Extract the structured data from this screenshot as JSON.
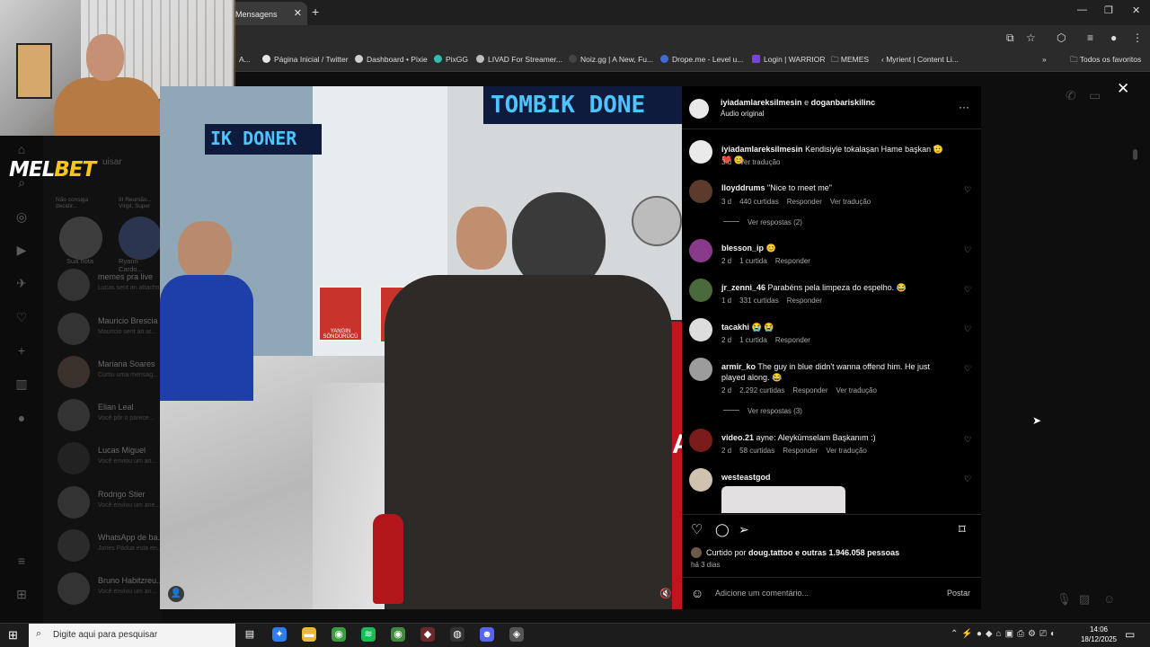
{
  "browser": {
    "active_tab": "Mensagens",
    "bookmarks": [
      {
        "label": "A...",
        "color": "#555555"
      },
      {
        "label": "Página Inicial / Twitter",
        "color": "#e7e7e7"
      },
      {
        "label": "Dashboard • Pixie",
        "color": "#cfcfcf"
      },
      {
        "label": "PixGG",
        "color": "#32bcad"
      },
      {
        "label": "LIVAD For Streamer...",
        "color": "#bdbdbd"
      },
      {
        "label": "Noiz.gg | A New, Fu...",
        "color": "#1f1f1f"
      },
      {
        "label": "Drope.me - Level u...",
        "color": "#3e6bd6"
      },
      {
        "label": "Login | WARRIOR",
        "color": "#7a44d9"
      },
      {
        "label": "MEMES",
        "color": "#9a9a9a"
      },
      {
        "label": "Myrient | Content Li...",
        "color": "#8a8a8a"
      }
    ],
    "all_favorites": "Todos os favoritos"
  },
  "overlay": {
    "brand_a": "MEL",
    "brand_b": "BET"
  },
  "dm_sidebar": {
    "search_placeholder": "uisar",
    "notes": [
      {
        "label": "Não consiga decidir...",
        "name": "Sua nota"
      },
      {
        "label": "III Reunião... Virgil, Super",
        "name": "Ryann Cardo..."
      }
    ],
    "conversations": [
      {
        "name": "memes pra live",
        "preview": "Lucas sent an attachm..."
      },
      {
        "name": "Mauricio Brescia",
        "preview": "Mauricio sent an at..."
      },
      {
        "name": "Mariana Soares",
        "preview": "Curtiu uma mensag..."
      },
      {
        "name": "Elian Leal",
        "preview": "Você pôr o parece..."
      },
      {
        "name": "Lucas Miguel",
        "preview": "Você enviou um an..."
      },
      {
        "name": "Rodrigo Stier",
        "preview": "Você enviou um ane..."
      },
      {
        "name": "WhatsApp de ba...",
        "preview": "Jones Pádua esta en..."
      },
      {
        "name": "Bruno Habitzreu...",
        "preview": "Você enviou um an..."
      }
    ]
  },
  "video": {
    "sign_top": "TOMBIK DONE",
    "sign_left": "IK DONER",
    "ext_label_1": "YANGIN SÖNDÜRÜCÜ",
    "ext_label_2": "YANGIN SÖNDÜRÜCÜ",
    "side_text": "SAR"
  },
  "post": {
    "authors": "iyiadamlareksilmesin",
    "connector": "e",
    "coauthor": "doganbariskilinc",
    "audio": "Áudio original",
    "caption_user": "iyiadamlareksilmesin",
    "caption_text": "Kendisiyle tokalaşan Hame başkan 🫡 ❤️ 😊",
    "caption_meta": [
      "3 d",
      "Ver tradução"
    ],
    "comments": [
      {
        "user": "lloyddrums",
        "text": "\"Nice to meet me\"",
        "meta": [
          "3 d",
          "440 curtidas",
          "Responder",
          "Ver tradução"
        ],
        "replies": "Ver respostas (2)",
        "avatar_color": "#5a3b2c"
      },
      {
        "user": "blesson_ip",
        "text": "😊",
        "meta": [
          "2 d",
          "1 curtida",
          "Responder"
        ],
        "replies": "",
        "avatar_color": "#8a3a8a"
      },
      {
        "user": "jr_zenni_46",
        "text": "Parabéns pela limpeza do espelho. 😂",
        "meta": [
          "1 d",
          "331 curtidas",
          "Responder"
        ],
        "replies": "",
        "avatar_color": "#4b6a3b"
      },
      {
        "user": "tacakhi",
        "text": "😭 😭",
        "meta": [
          "2 d",
          "1 curtida",
          "Responder"
        ],
        "replies": "",
        "avatar_color": "#dddddd"
      },
      {
        "user": "armir_ko",
        "text": "The guy in blue didn't wanna offend him. He just played along. 😂",
        "meta": [
          "2 d",
          "2.292 curtidas",
          "Responder",
          "Ver tradução"
        ],
        "replies": "Ver respostas (3)",
        "avatar_color": "#9c9c9c"
      },
      {
        "user": "video.21",
        "text": "ayne: Aleykümselam Başkanım :)",
        "meta": [
          "2 d",
          "58 curtidas",
          "Responder",
          "Ver tradução"
        ],
        "replies": "",
        "avatar_color": "#7b1c1c"
      },
      {
        "user": "westeastgod",
        "text": "",
        "meta": [],
        "replies": "",
        "avatar_color": "#cfc3b0"
      }
    ],
    "liked_by_prefix": "Curtido por",
    "liked_by_user": "doug.tattoo",
    "liked_by_suffix": "e outras 1.946.058 pessoas",
    "posted_ago": "há 3 dias",
    "comment_placeholder": "Adicione um comentário...",
    "post_button": "Postar"
  },
  "taskbar": {
    "search_placeholder": "Digite aqui para pesquisar",
    "time": "14:06",
    "date": "18/12/2025"
  }
}
